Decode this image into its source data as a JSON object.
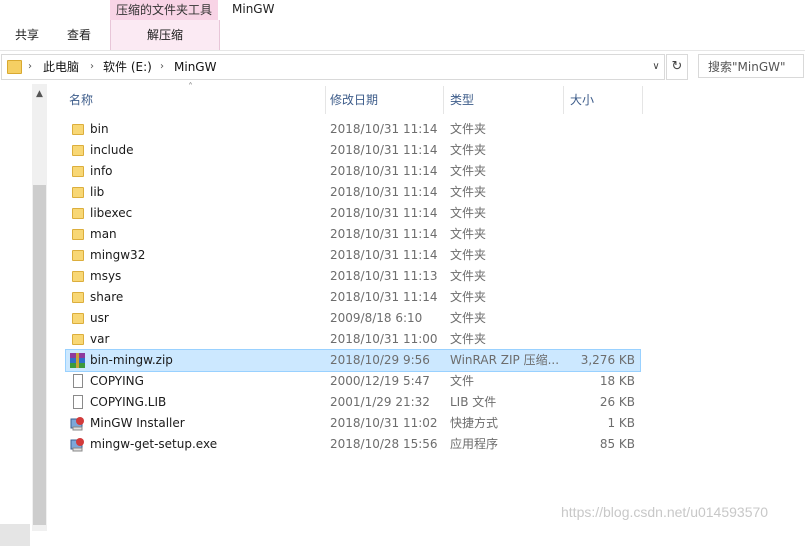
{
  "window": {
    "title": "MinGW"
  },
  "ribbon": {
    "tabs": [
      {
        "label": "共享"
      },
      {
        "label": "查看"
      }
    ],
    "context_group": "压缩的文件夹工具",
    "context_tab": "解压缩"
  },
  "address": {
    "breadcrumbs": [
      "此电脑",
      "软件 (E:)",
      "MinGW"
    ]
  },
  "search": {
    "placeholder": "搜索\"MinGW\""
  },
  "columns": {
    "name": "名称",
    "date": "修改日期",
    "type": "类型",
    "size": "大小"
  },
  "files": [
    {
      "name": "bin",
      "date": "2018/10/31 11:14",
      "type": "文件夹",
      "size": "",
      "icon": "folder-icon"
    },
    {
      "name": "include",
      "date": "2018/10/31 11:14",
      "type": "文件夹",
      "size": "",
      "icon": "folder-icon"
    },
    {
      "name": "info",
      "date": "2018/10/31 11:14",
      "type": "文件夹",
      "size": "",
      "icon": "folder-icon"
    },
    {
      "name": "lib",
      "date": "2018/10/31 11:14",
      "type": "文件夹",
      "size": "",
      "icon": "folder-icon"
    },
    {
      "name": "libexec",
      "date": "2018/10/31 11:14",
      "type": "文件夹",
      "size": "",
      "icon": "folder-icon"
    },
    {
      "name": "man",
      "date": "2018/10/31 11:14",
      "type": "文件夹",
      "size": "",
      "icon": "folder-icon"
    },
    {
      "name": "mingw32",
      "date": "2018/10/31 11:14",
      "type": "文件夹",
      "size": "",
      "icon": "folder-icon"
    },
    {
      "name": "msys",
      "date": "2018/10/31 11:13",
      "type": "文件夹",
      "size": "",
      "icon": "folder-icon"
    },
    {
      "name": "share",
      "date": "2018/10/31 11:14",
      "type": "文件夹",
      "size": "",
      "icon": "folder-icon"
    },
    {
      "name": "usr",
      "date": "2009/8/18 6:10",
      "type": "文件夹",
      "size": "",
      "icon": "folder-icon"
    },
    {
      "name": "var",
      "date": "2018/10/31 11:00",
      "type": "文件夹",
      "size": "",
      "icon": "folder-icon"
    },
    {
      "name": "bin-mingw.zip",
      "date": "2018/10/29 9:56",
      "type": "WinRAR ZIP 压缩...",
      "size": "3,276 KB",
      "icon": "winrar-zip-icon",
      "selected": true
    },
    {
      "name": "COPYING",
      "date": "2000/12/19 5:47",
      "type": "文件",
      "size": "18 KB",
      "icon": "file-icon"
    },
    {
      "name": "COPYING.LIB",
      "date": "2001/1/29 21:32",
      "type": "LIB 文件",
      "size": "26 KB",
      "icon": "file-icon"
    },
    {
      "name": "MinGW Installer",
      "date": "2018/10/31 11:02",
      "type": "快捷方式",
      "size": "1 KB",
      "icon": "installer-shortcut-icon"
    },
    {
      "name": "mingw-get-setup.exe",
      "date": "2018/10/28 15:56",
      "type": "应用程序",
      "size": "85 KB",
      "icon": "installer-exe-icon"
    }
  ],
  "watermark": "https://blog.csdn.net/u014593570",
  "colors": {
    "selection": "#cce8ff",
    "context_tab": "#f8d4e6",
    "folder": "#f8d775"
  }
}
